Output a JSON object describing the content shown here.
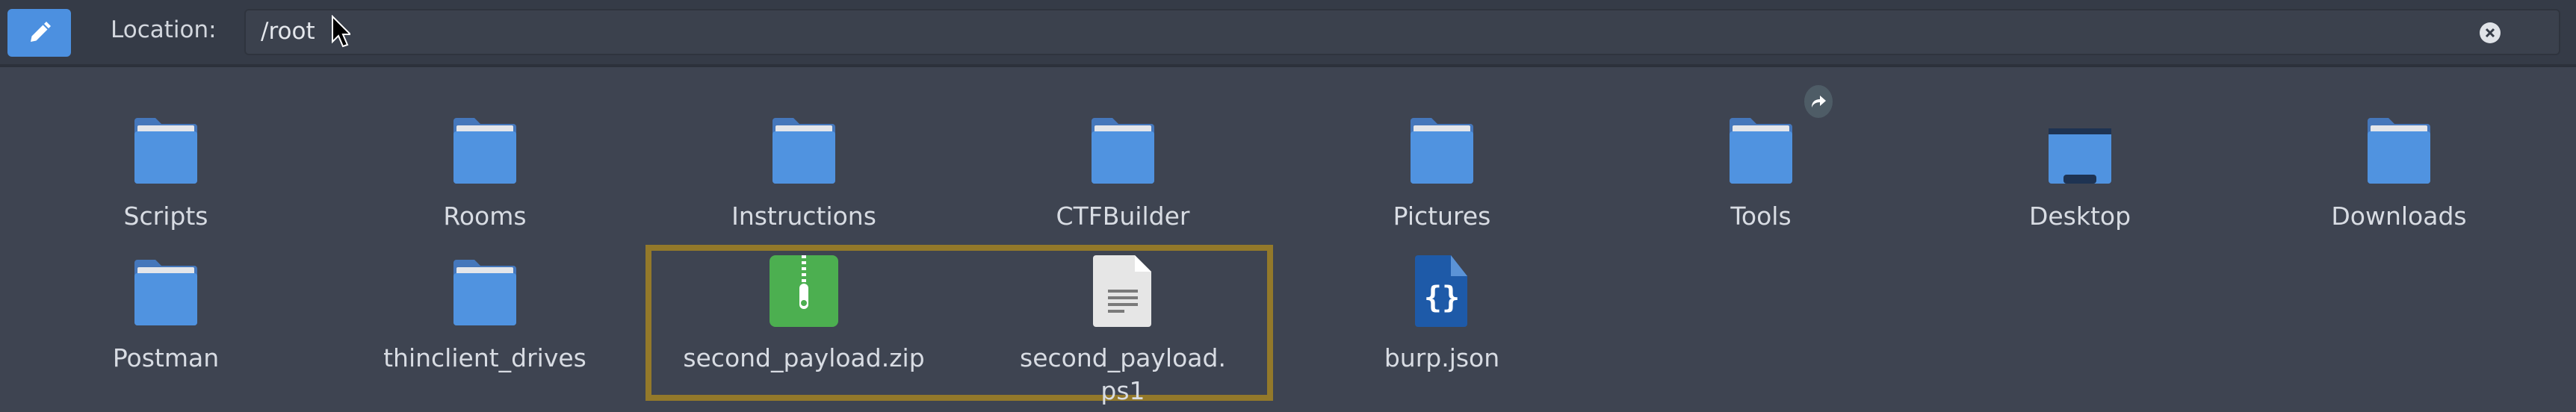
{
  "toolbar": {
    "edit_icon": "pencil-icon",
    "location_label": "Location:",
    "location_value": "/root",
    "clear_icon": "clear-circle-icon"
  },
  "accent_color": "#4c90e0",
  "selection_color": "#93792a",
  "items": [
    {
      "name": "Scripts",
      "icon": "folder"
    },
    {
      "name": "Rooms",
      "icon": "folder"
    },
    {
      "name": "Instructions",
      "icon": "folder"
    },
    {
      "name": "CTFBuilder",
      "icon": "folder"
    },
    {
      "name": "Pictures",
      "icon": "folder"
    },
    {
      "name": "Tools",
      "icon": "folder-symlink"
    },
    {
      "name": "Desktop",
      "icon": "desktop-folder"
    },
    {
      "name": "Downloads",
      "icon": "folder"
    },
    {
      "name": "Postman",
      "icon": "folder"
    },
    {
      "name": "thinclient_drives",
      "icon": "folder"
    },
    {
      "name": "second_payload.zip",
      "icon": "zip-archive"
    },
    {
      "name": "second_payload.ps1",
      "label_line1": "second_payload.",
      "label_line2": "ps1",
      "icon": "text-file"
    },
    {
      "name": "burp.json",
      "icon": "json-file"
    }
  ]
}
